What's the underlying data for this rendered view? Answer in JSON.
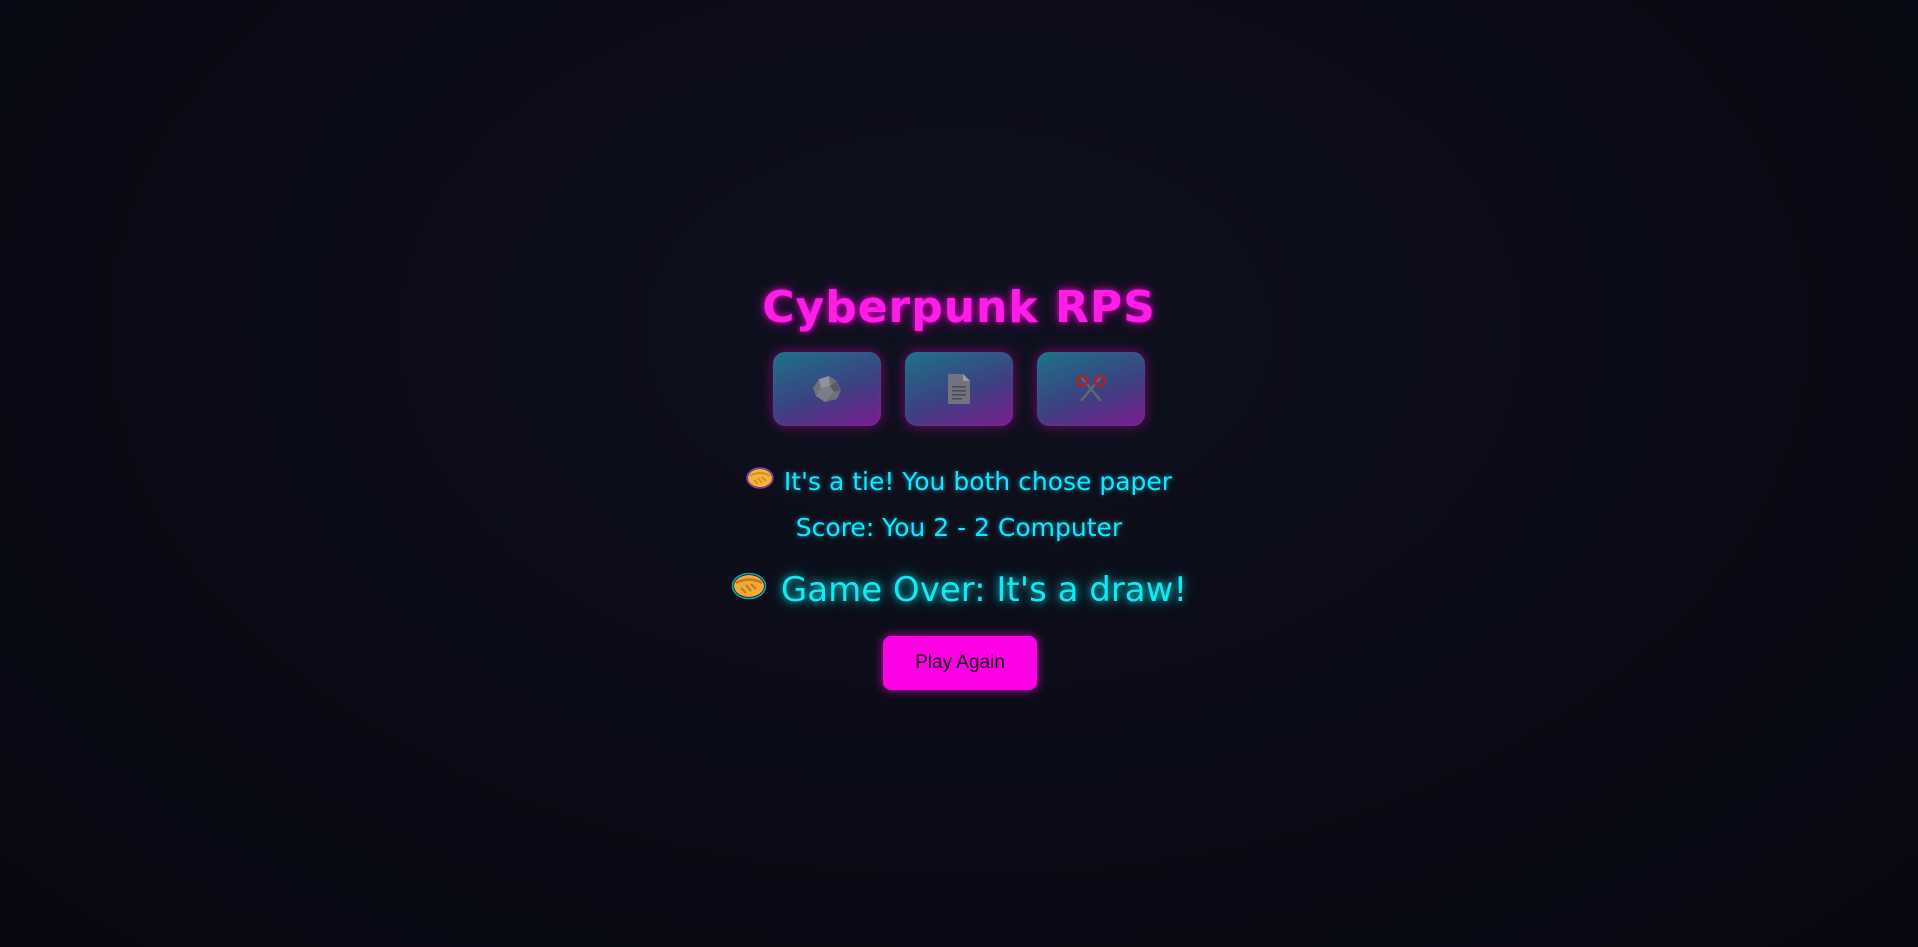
{
  "game": {
    "title": "Cyberpunk RPS"
  },
  "choices": [
    {
      "name": "rock",
      "icon": "rock-icon"
    },
    {
      "name": "paper",
      "icon": "paper-icon"
    },
    {
      "name": "scissors",
      "icon": "scissors-icon"
    }
  ],
  "result": {
    "icon": "handshake-icon",
    "text": "It's a tie! You both chose paper"
  },
  "score": {
    "text": "Score: You 2 - 2 Computer",
    "player": 2,
    "computer": 2
  },
  "game_over": {
    "icon": "handshake-icon",
    "text": "Game Over: It's a draw!"
  },
  "actions": {
    "play_again_label": "Play Again"
  },
  "colors": {
    "accent_magenta": "#ff00e6",
    "accent_cyan": "#18e6ff",
    "background": "#0a0b16"
  }
}
